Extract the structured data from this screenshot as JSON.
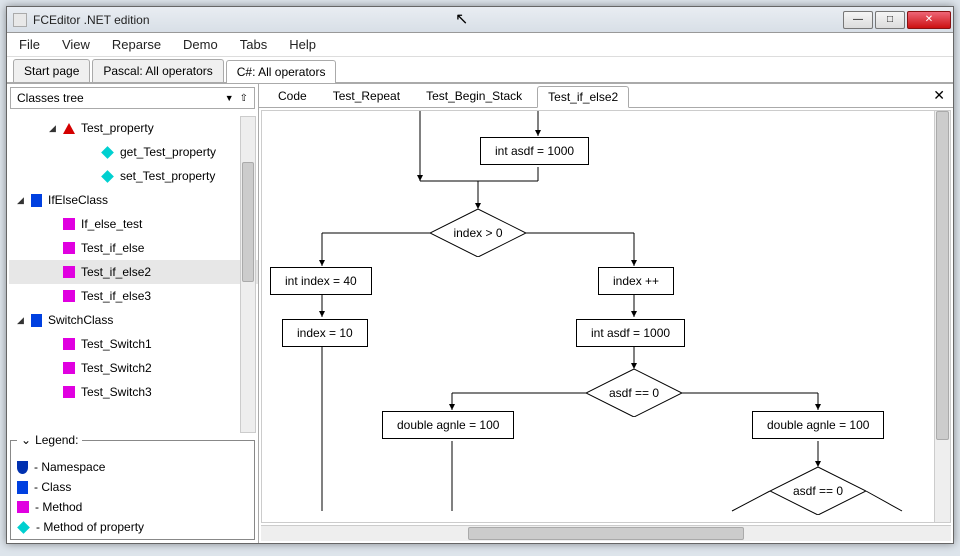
{
  "window": {
    "title": "FCEditor .NET edition",
    "controls": {
      "min": "—",
      "max": "□",
      "close": "✕"
    }
  },
  "cursor_glyph": "↖",
  "menu": [
    "File",
    "View",
    "Reparse",
    "Demo",
    "Tabs",
    "Help"
  ],
  "file_tabs": [
    {
      "label": "Start page",
      "active": false
    },
    {
      "label": "Pascal: All operators",
      "active": false
    },
    {
      "label": "C#: All operators",
      "active": true
    }
  ],
  "sidebar": {
    "header": "Classes tree",
    "tree": [
      {
        "indent": 1,
        "chev": "◢",
        "icon": "tri-red",
        "label": "Test_property",
        "selected": false
      },
      {
        "indent": 2,
        "chev": "",
        "icon": "diamond-cyan",
        "label": "get_Test_property",
        "selected": false
      },
      {
        "indent": 2,
        "chev": "",
        "icon": "diamond-cyan",
        "label": "set_Test_property",
        "selected": false
      },
      {
        "indent": 0,
        "chev": "◢",
        "icon": "square-blue",
        "label": "IfElseClass",
        "selected": false
      },
      {
        "indent": 1,
        "chev": "",
        "icon": "square-magenta",
        "label": "If_else_test",
        "selected": false
      },
      {
        "indent": 1,
        "chev": "",
        "icon": "square-magenta",
        "label": "Test_if_else",
        "selected": false
      },
      {
        "indent": 1,
        "chev": "",
        "icon": "square-magenta",
        "label": "Test_if_else2",
        "selected": true
      },
      {
        "indent": 1,
        "chev": "",
        "icon": "square-magenta",
        "label": "Test_if_else3",
        "selected": false
      },
      {
        "indent": 0,
        "chev": "◢",
        "icon": "square-blue",
        "label": "SwitchClass",
        "selected": false
      },
      {
        "indent": 1,
        "chev": "",
        "icon": "square-magenta",
        "label": "Test_Switch1",
        "selected": false
      },
      {
        "indent": 1,
        "chev": "",
        "icon": "square-magenta",
        "label": "Test_Switch2",
        "selected": false
      },
      {
        "indent": 1,
        "chev": "",
        "icon": "square-magenta",
        "label": "Test_Switch3",
        "selected": false
      }
    ],
    "legend": {
      "title": "Legend:",
      "items": [
        {
          "icon": "shield",
          "label": " - Namespace"
        },
        {
          "icon": "square-blue",
          "label": " - Class"
        },
        {
          "icon": "square-magenta",
          "label": " - Method"
        },
        {
          "icon": "diamond-cyan",
          "label": " - Method of property"
        }
      ]
    }
  },
  "sub_tabs": [
    {
      "label": "Code",
      "active": false
    },
    {
      "label": "Test_Repeat",
      "active": false
    },
    {
      "label": "Test_Begin_Stack",
      "active": false
    },
    {
      "label": "Test_if_else2",
      "active": true
    }
  ],
  "flowchart": {
    "n_asdf": "int  asdf = 1000",
    "d_index_gt": "index > 0",
    "n_index40": "int  index = 40",
    "n_indexpp": "index ++",
    "n_index10": "index = 10",
    "n_asdf2": "int  asdf = 1000",
    "d_asdf0": "asdf == 0",
    "n_agnle_l": "double  agnle = 100",
    "n_agnle_r": "double  agnle = 100",
    "d_asdf0b": "asdf == 0"
  }
}
